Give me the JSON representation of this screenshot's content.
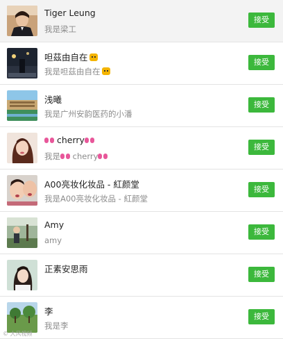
{
  "accept_label": "接受",
  "watermark": "© 大风视频",
  "requests": [
    {
      "name": "Tiger Leung",
      "message": "我是梁工",
      "avatar_icon": "man-in-suit-photo"
    },
    {
      "name": "呾茲由自在",
      "name_emoji": "tiger-emoji",
      "message": "我是呾茲由自在",
      "message_emoji": "tiger-emoji",
      "avatar_icon": "dark-street-photo"
    },
    {
      "name": "浅曦",
      "message": "我是广州安韵医药的小潘",
      "avatar_icon": "building-photo"
    },
    {
      "name_prefix_emoji": "bow-emoji",
      "name": "cherry",
      "name_suffix_emoji": "bow-emoji",
      "message_prefix": "我是",
      "message_emoji1": "bow-emoji",
      "message": "cherry",
      "message_emoji2": "bow-emoji",
      "avatar_icon": "woman-portrait-photo"
    },
    {
      "name": "A00亮妆化妆品 - 紅颜堂",
      "message": "我是A00亮妆化妆品 - 紅颜堂",
      "avatar_icon": "children-photo"
    },
    {
      "name": "Amy",
      "message": "amy",
      "avatar_icon": "outdoor-person-photo"
    },
    {
      "name": "正素安思雨",
      "message": "",
      "avatar_icon": "girl-photo"
    },
    {
      "name": "李",
      "message": "我是李",
      "avatar_icon": "landscape-photo"
    }
  ]
}
